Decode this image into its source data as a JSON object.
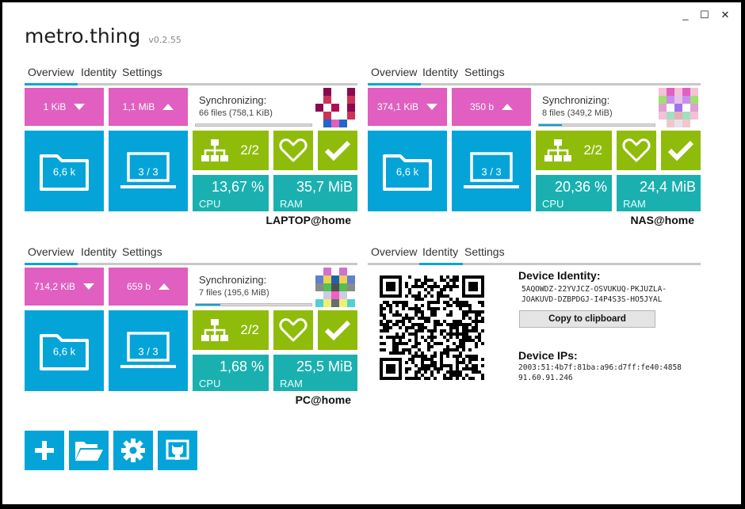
{
  "app": {
    "title": "metro.thing",
    "version": "v0.2.55"
  },
  "window_controls": {
    "minimize": "_",
    "maximize": "☐",
    "close": "✕"
  },
  "tabs": {
    "overview": "Overview",
    "identity": "Identity",
    "settings": "Settings"
  },
  "labels": {
    "synchronizing": "Synchronizing:",
    "cpu": "CPU",
    "ram": "RAM"
  },
  "colors": {
    "pink": "#e05fc0",
    "blue": "#05a4d8",
    "green": "#8fbc0a",
    "teal": "#1bb0b0"
  },
  "devices": [
    {
      "host": "LAPTOP@home",
      "download": "1 KiB",
      "upload": "1,1 MiB",
      "sync_files": "66 files (758,1 KiB)",
      "sync_progress": 0.0,
      "local_files": "6,6 k",
      "connected": "3 / 3",
      "peers": "2/2",
      "cpu": "13,67 %",
      "ram": "35,7 MiB"
    },
    {
      "host": "NAS@home",
      "download": "374,1 KiB",
      "upload": "350 b",
      "sync_files": "8 files (349,2 MiB)",
      "sync_progress": 0.2,
      "local_files": "6,6 k",
      "connected": "3 / 3",
      "peers": "2/2",
      "cpu": "20,36 %",
      "ram": "24,4 MiB"
    },
    {
      "host": "PC@home",
      "download": "714,2 KiB",
      "upload": "659 b",
      "sync_files": "7 files (195,6 MiB)",
      "sync_progress": 0.21,
      "local_files": "6,6 k",
      "connected": "3 / 3",
      "peers": "2/2",
      "cpu": "1,68 %",
      "ram": "25,5 MiB"
    }
  ],
  "identity": {
    "heading": "Device Identity:",
    "id_line1": "5AQOWDZ-22YVJCZ-OSVUKUQ-PKJUZLA-",
    "id_line2": "JOAKUVD-DZBPDGJ-I4P4S3S-HO5JYAL",
    "copy_button": "Copy to clipboard",
    "ips_heading": "Device IPs:",
    "ip1": "2003:51:4b7f:81ba:a96:d7ff:fe40:4858",
    "ip2": "91.60.91.246"
  },
  "actions": [
    "plus-icon",
    "folder-open-icon",
    "gear-icon",
    "github-icon"
  ]
}
